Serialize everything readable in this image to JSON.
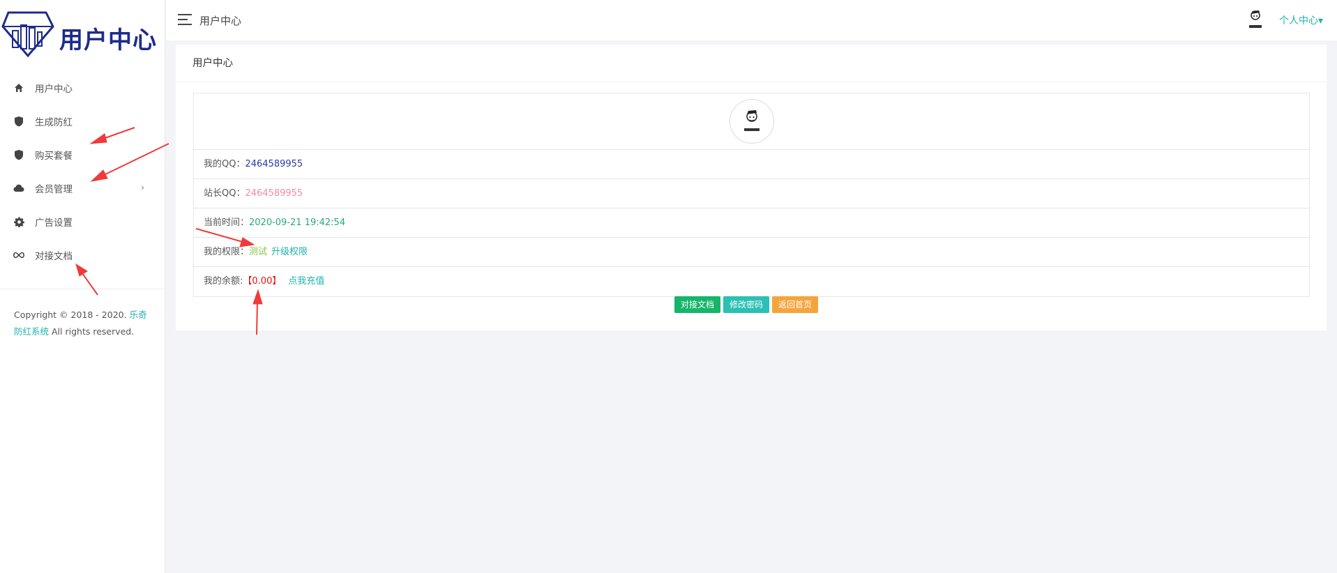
{
  "sidebar": {
    "logo_text": "用户中心",
    "items": [
      {
        "label": "用户中心",
        "icon": "home-icon"
      },
      {
        "label": "生成防红",
        "icon": "shield-icon"
      },
      {
        "label": "购买套餐",
        "icon": "shield-icon"
      },
      {
        "label": "会员管理",
        "icon": "cloud-icon",
        "arrow": "›"
      },
      {
        "label": "广告设置",
        "icon": "gear-icon"
      },
      {
        "label": "对接文档",
        "icon": "infinity-icon"
      }
    ],
    "copyright_prefix": "Copyright © 2018 - 2020.",
    "copyright_link": "乐奇防红系统",
    "copyright_suffix": "All rights reserved."
  },
  "header": {
    "title": "用户中心",
    "user_menu": "个人中心▾"
  },
  "panel": {
    "title": "用户中心",
    "rows": {
      "my_qq_label": "我的QQ：",
      "my_qq_value": "2464589955",
      "admin_qq_label": "站长QQ：",
      "admin_qq_value": "2464589955",
      "time_label": "当前时间：",
      "time_value": "2020-09-21 19:42:54",
      "perm_label": "我的权限：",
      "perm_value": "测试",
      "perm_link": "升级权限",
      "balance_label": "我的余额:",
      "balance_value": "【0.00】",
      "balance_link": "点我充值"
    },
    "buttons": {
      "docs": "对接文档",
      "change_password": "修改密码",
      "home": "返回首页"
    }
  },
  "colors": {
    "accent": "#20b2aa",
    "logo": "#1e2c8a",
    "green_button": "#16b56a",
    "teal_button": "#2bc0b4",
    "orange_button": "#f5a43c",
    "annotation_arrow": "#f03a3a"
  }
}
